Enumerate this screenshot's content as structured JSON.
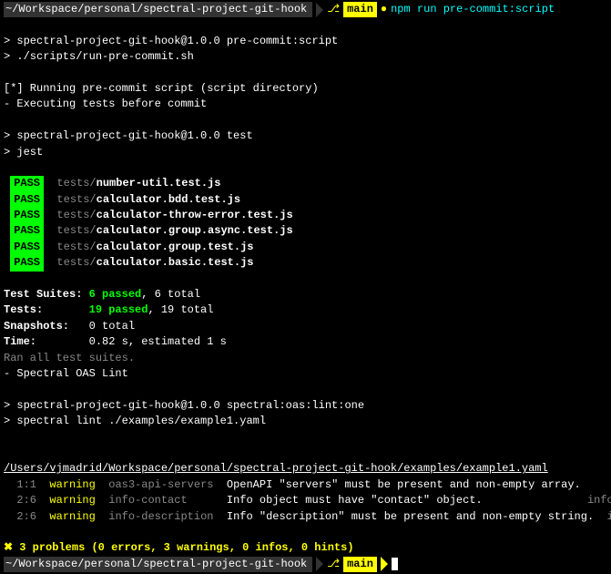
{
  "prompt1": {
    "path": "~/Workspace/personal/spectral-project-git-hook",
    "branch_icon": "⎇",
    "branch": "main",
    "bullet": "●",
    "command": "npm run pre-commit:script"
  },
  "out": {
    "blank": " ",
    "l1": "> spectral-project-git-hook@1.0.0 pre-commit:script",
    "l2": "> ./scripts/run-pre-commit.sh",
    "l3": "[*] Running pre-commit script (script directory)",
    "l4": "- Executing tests before commit",
    "l5": "> spectral-project-git-hook@1.0.0 test",
    "l6": "> jest"
  },
  "pass_label": "PASS",
  "tests_dir": "tests/",
  "test_files": [
    "number-util.test.js",
    "calculator.bdd.test.js",
    "calculator-throw-error.test.js",
    "calculator.group.async.test.js",
    "calculator.group.test.js",
    "calculator.basic.test.js"
  ],
  "summary": {
    "suites_label": "Test Suites:",
    "suites_pass": "6 passed",
    "suites_total": ", 6 total",
    "tests_label": "Tests:      ",
    "tests_pass": "19 passed",
    "tests_total": ", 19 total",
    "snap_label": "Snapshots:  ",
    "snap_val": "0 total",
    "time_label": "Time:       ",
    "time_val": "0.82 s, estimated 1 s",
    "ran": "Ran all test suites.",
    "spectral": "- Spectral OAS Lint"
  },
  "spec": {
    "l1": "> spectral-project-git-hook@1.0.0 spectral:oas:lint:one",
    "l2": "> spectral lint ./examples/example1.yaml"
  },
  "lint": {
    "file": "/Users/vjmadrid/Workspace/personal/spectral-project-git-hook/examples/example1.yaml",
    "rows": [
      {
        "loc": "  1:1  ",
        "sev": "warning",
        "rule": "  oas3-api-servers  ",
        "msg": "OpenAPI \"servers\" must be present and non-empty array.",
        "trail": ""
      },
      {
        "loc": "  2:6  ",
        "sev": "warning",
        "rule": "  info-contact      ",
        "msg": "Info object must have \"contact\" object.               ",
        "trail": " info"
      },
      {
        "loc": "  2:6  ",
        "sev": "warning",
        "rule": "  info-description  ",
        "msg": "Info \"description\" must be present and non-empty string.",
        "trail": "  info"
      }
    ],
    "problems": "✖ 3 problems (0 errors, 3 warnings, 0 infos, 0 hints)"
  },
  "prompt2": {
    "path": "~/Workspace/personal/spectral-project-git-hook",
    "branch_icon": "⎇",
    "branch": "main"
  }
}
